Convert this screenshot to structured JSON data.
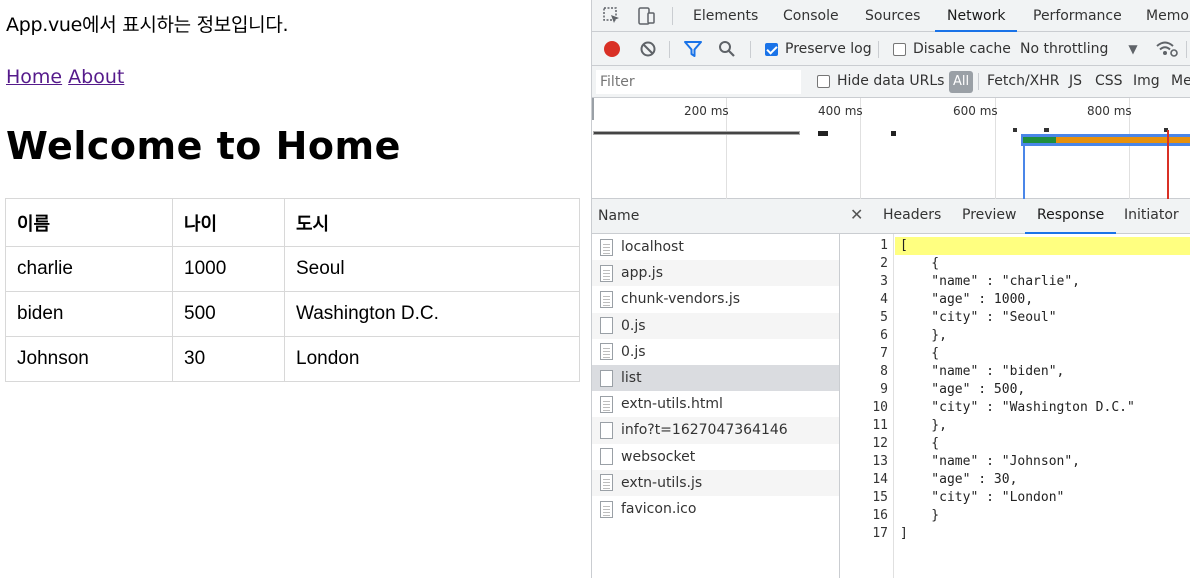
{
  "app": {
    "message": "App.vue에서 표시하는 정보입니다.",
    "nav": [
      {
        "label": "Home"
      },
      {
        "label": "About"
      }
    ],
    "title": "Welcome to Home",
    "table": {
      "headers": [
        "이름",
        "나이",
        "도시"
      ],
      "rows": [
        [
          "charlie",
          "1000",
          "Seoul"
        ],
        [
          "biden",
          "500",
          "Washington D.C."
        ],
        [
          "Johnson",
          "30",
          "London"
        ]
      ]
    }
  },
  "devtools": {
    "tabs": [
      "Elements",
      "Console",
      "Sources",
      "Network",
      "Performance",
      "Memor"
    ],
    "active_tab": "Network",
    "toolbar": {
      "preserve_log": "Preserve log",
      "preserve_log_checked": true,
      "disable_cache": "Disable cache",
      "disable_cache_checked": false,
      "throttling": "No throttling"
    },
    "filterbar": {
      "placeholder": "Filter",
      "hide_data_urls": "Hide data URLs",
      "types": [
        "All",
        "Fetch/XHR",
        "JS",
        "CSS",
        "Img",
        "Me"
      ]
    },
    "overview": {
      "ticks": [
        "200 ms",
        "400 ms",
        "600 ms",
        "800 ms"
      ]
    },
    "requests": {
      "header": "Name",
      "items": [
        {
          "name": "localhost",
          "icon": "document-icon"
        },
        {
          "name": "app.js",
          "icon": "document-icon"
        },
        {
          "name": "chunk-vendors.js",
          "icon": "document-icon"
        },
        {
          "name": "0.js",
          "icon": "file-icon"
        },
        {
          "name": "0.js",
          "icon": "document-icon"
        },
        {
          "name": "list",
          "icon": "file-icon"
        },
        {
          "name": "extn-utils.html",
          "icon": "document-icon"
        },
        {
          "name": "info?t=1627047364146",
          "icon": "file-icon"
        },
        {
          "name": "websocket",
          "icon": "file-icon"
        },
        {
          "name": "extn-utils.js",
          "icon": "document-icon"
        },
        {
          "name": "favicon.ico",
          "icon": "document-icon"
        }
      ],
      "selected": "list"
    },
    "detail": {
      "tabs": [
        "Headers",
        "Preview",
        "Response",
        "Initiator"
      ],
      "active_tab": "Response",
      "lines": [
        {
          "n": "1",
          "t": "["
        },
        {
          "n": "2",
          "t": "    {"
        },
        {
          "n": "3",
          "t": "    \"name\" : \"charlie\","
        },
        {
          "n": "4",
          "t": "    \"age\" : 1000,"
        },
        {
          "n": "5",
          "t": "    \"city\" : \"Seoul\""
        },
        {
          "n": "6",
          "t": "    },"
        },
        {
          "n": "7",
          "t": "    {"
        },
        {
          "n": "8",
          "t": "    \"name\" : \"biden\","
        },
        {
          "n": "9",
          "t": "    \"age\" : 500,"
        },
        {
          "n": "10",
          "t": "    \"city\" : \"Washington D.C.\""
        },
        {
          "n": "11",
          "t": "    },"
        },
        {
          "n": "12",
          "t": "    {"
        },
        {
          "n": "13",
          "t": "    \"name\" : \"Johnson\","
        },
        {
          "n": "14",
          "t": "    \"age\" : 30,"
        },
        {
          "n": "15",
          "t": "    \"city\" : \"London\""
        },
        {
          "n": "16",
          "t": "    }"
        },
        {
          "n": "17",
          "t": "]"
        }
      ]
    }
  }
}
